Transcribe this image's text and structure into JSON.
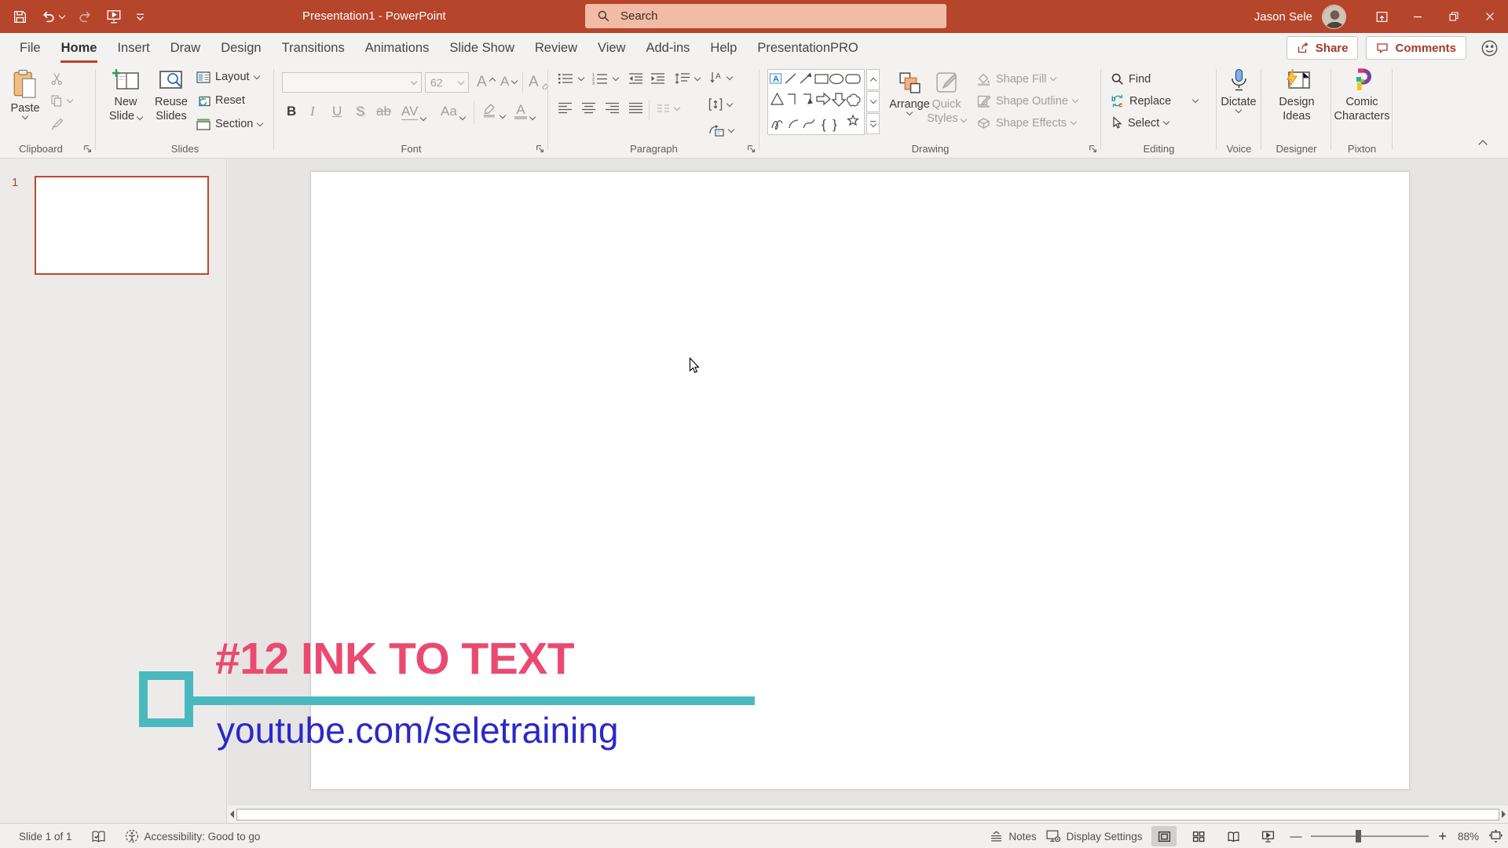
{
  "colors": {
    "titlebar": "#B5452B",
    "tab_accent": "#C4401F",
    "action_text": "#A4392B",
    "slide_title_pink": "#EA4A71",
    "overlay_teal": "#4BB8BF",
    "url_blue": "#2B28C8",
    "dictate_blue": "#7EB1E8",
    "new_slide_green": "#2E9E4F"
  },
  "titlebar": {
    "title": "Presentation1 - PowerPoint",
    "search_placeholder": "Search",
    "user": "Jason Sele"
  },
  "tabs": [
    "File",
    "Home",
    "Insert",
    "Draw",
    "Design",
    "Transitions",
    "Animations",
    "Slide Show",
    "Review",
    "View",
    "Add-ins",
    "Help",
    "PresentationPRO"
  ],
  "actions": {
    "share": "Share",
    "comments": "Comments"
  },
  "ribbon": {
    "clipboard": {
      "label": "Clipboard",
      "paste": "Paste"
    },
    "slides": {
      "label": "Slides",
      "new_slide": [
        "New",
        "Slide"
      ],
      "reuse_slides": [
        "Reuse",
        "Slides"
      ],
      "layout": "Layout",
      "reset": "Reset",
      "section": "Section"
    },
    "font": {
      "label": "Font",
      "font_name": "",
      "size": "62",
      "bold": "B",
      "italic": "I",
      "underline": "U",
      "shadow": "S",
      "strikethrough": "ab",
      "char_spacing": "AV",
      "change_case": "Aa"
    },
    "paragraph": {
      "label": "Paragraph"
    },
    "drawing": {
      "label": "Drawing",
      "arrange": "Arrange",
      "quick_styles": [
        "Quick",
        "Styles"
      ],
      "shape_fill": "Shape Fill",
      "shape_outline": "Shape Outline",
      "shape_effects": "Shape Effects"
    },
    "editing": {
      "label": "Editing",
      "find": "Find",
      "replace": "Replace",
      "select": "Select"
    },
    "voice": {
      "label": "Voice",
      "dictate": "Dictate"
    },
    "designer": {
      "label": "Designer",
      "design_ideas": [
        "Design",
        "Ideas"
      ]
    },
    "pixton": {
      "label": "Pixton",
      "comic_characters": [
        "Comic",
        "Characters"
      ]
    }
  },
  "slide_panel": {
    "slide_number": "1"
  },
  "slide": {
    "heading": "#12 INK TO TEXT",
    "url": "youtube.com/seletraining"
  },
  "statusbar": {
    "slide_indicator": "Slide 1 of 1",
    "accessibility": "Accessibility: Good to go",
    "notes": "Notes",
    "display_settings": "Display Settings",
    "zoom_out": "—",
    "zoom_in": "+",
    "zoom_level": "88%"
  }
}
